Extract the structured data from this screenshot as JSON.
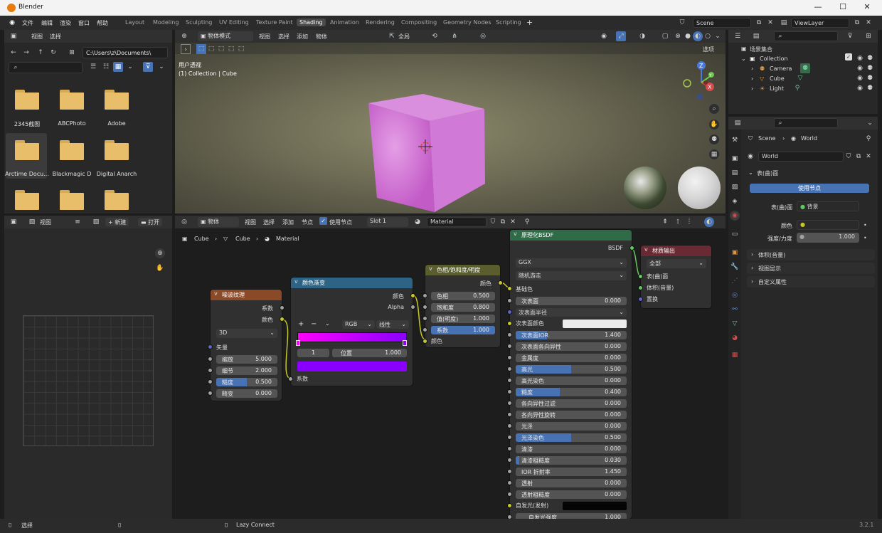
{
  "window": {
    "title": "Blender",
    "controls": [
      "—",
      "☐",
      "✕"
    ]
  },
  "menu": [
    "文件",
    "编辑",
    "渲染",
    "窗口",
    "帮助"
  ],
  "workspaces": [
    "Layout",
    "Modeling",
    "Sculpting",
    "UV Editing",
    "Texture Paint",
    "Shading",
    "Animation",
    "Rendering",
    "Compositing",
    "Geometry Nodes",
    "Scripting"
  ],
  "active_workspace": "Shading",
  "top_right": {
    "scene": "Scene",
    "view_layer": "ViewLayer"
  },
  "file_browser": {
    "menu": [
      "视图",
      "选择"
    ],
    "path": "C:\\Users\\z\\Documents\\",
    "folders": [
      "2345截图",
      "ABCPhoto",
      "Adobe",
      "Arctime Docu...",
      "Blackmagic D",
      "Digital Anarch"
    ]
  },
  "image_editor": {
    "view": "视图",
    "new": "+ 新建",
    "open": "打开"
  },
  "viewport": {
    "mode": "物体模式",
    "menu": [
      "视图",
      "选择",
      "添加",
      "物体"
    ],
    "orientation": "全局",
    "view_label": "用户透视",
    "collection_label": "(1) Collection | Cube",
    "options": "选项",
    "gizmo": {
      "x": "X",
      "y": "Y",
      "z": "Z"
    }
  },
  "node_editor": {
    "object": "物体",
    "menu": [
      "视图",
      "选择",
      "添加",
      "节点"
    ],
    "use_nodes": "使用节点",
    "slot": "Slot 1",
    "material": "Material",
    "breadcrumb": [
      "Cube",
      "Cube",
      "Material"
    ]
  },
  "nodes": {
    "noise": {
      "title": "噪波纹理",
      "out1": "系数",
      "out2": "颜色",
      "dim": "3D",
      "vector": "矢量",
      "rows": [
        {
          "label": "缩放",
          "value": "5.000",
          "fill": 0
        },
        {
          "label": "细节",
          "value": "2.000",
          "fill": 0
        },
        {
          "label": "糙度",
          "value": "0.500",
          "fill": 0.5
        },
        {
          "label": "畸变",
          "value": "0.000",
          "fill": 0
        }
      ]
    },
    "ramp": {
      "title": "颜色渐变",
      "out1": "颜色",
      "out2": "Alpha",
      "mode": "RGB",
      "interp": "线性",
      "index": "1",
      "pos_label": "位置",
      "pos_value": "1.000",
      "in": "系数",
      "color_a": "#ff00ff",
      "color_b": "#8a00ff"
    },
    "hsv": {
      "title": "色相/饱和度/明度",
      "out": "颜色",
      "rows": [
        {
          "label": "色相",
          "value": "0.500",
          "fill": 0
        },
        {
          "label": "饱和度",
          "value": "0.800",
          "fill": 0
        },
        {
          "label": "值(明度)",
          "value": "1.000",
          "fill": 0
        },
        {
          "label": "系数",
          "value": "1.000",
          "fill": 1
        }
      ],
      "in": "颜色"
    },
    "bsdf": {
      "title": "原理化BSDF",
      "out": "BSDF",
      "distribution": "GGX",
      "subsurface_method": "随机游走",
      "base_color": "基础色",
      "sss_radius": "次表面半径",
      "sss_color": "次表面颜色",
      "emission": "自发光(发射)",
      "rows": [
        {
          "label": "次表面",
          "value": "0.000",
          "fill": 0
        },
        {
          "label": "次表面IOR",
          "value": "1.400",
          "fill": 0.28
        },
        {
          "label": "次表面各向异性",
          "value": "0.000",
          "fill": 0
        },
        {
          "label": "金属度",
          "value": "0.000",
          "fill": 0
        },
        {
          "label": "高光",
          "value": "0.500",
          "fill": 0.5
        },
        {
          "label": "高光染色",
          "value": "0.000",
          "fill": 0
        },
        {
          "label": "糙度",
          "value": "0.400",
          "fill": 0.4
        },
        {
          "label": "各向异性过滤",
          "value": "0.000",
          "fill": 0
        },
        {
          "label": "各向异性旋转",
          "value": "0.000",
          "fill": 0
        },
        {
          "label": "光泽",
          "value": "0.000",
          "fill": 0
        },
        {
          "label": "光泽染色",
          "value": "0.500",
          "fill": 0.5
        },
        {
          "label": "清漆",
          "value": "0.000",
          "fill": 0
        },
        {
          "label": "清漆粗糙度",
          "value": "0.030",
          "fill": 0.03
        },
        {
          "label": "IOR 折射率",
          "value": "1.450",
          "fill": 0
        },
        {
          "label": "透射",
          "value": "0.000",
          "fill": 0
        },
        {
          "label": "透射粗糙度",
          "value": "0.000",
          "fill": 0
        }
      ],
      "emission_strength": {
        "label": "自发光强度",
        "value": "1.000"
      }
    },
    "output": {
      "title": "材质输出",
      "target": "全部",
      "inputs": [
        "表(曲)面",
        "体积(音量)",
        "置换"
      ]
    }
  },
  "outliner": {
    "root": "场景集合",
    "collection": "Collection",
    "items": [
      "Camera",
      "Cube",
      "Light"
    ]
  },
  "properties": {
    "breadcrumb": [
      "Scene",
      "World"
    ],
    "world": "World",
    "surface_section": "表(曲)面",
    "use_nodes": "使用节点",
    "surface_label": "表(曲)面",
    "surface_value": "背景",
    "color_label": "颜色",
    "strength_label": "强度/力度",
    "strength_value": "1.000",
    "sections": [
      "体积(音量)",
      "视图显示",
      "自定义属性"
    ]
  },
  "statusbar": {
    "select": "选择",
    "lazy": "Lazy Connect",
    "version": "3.2.1"
  }
}
